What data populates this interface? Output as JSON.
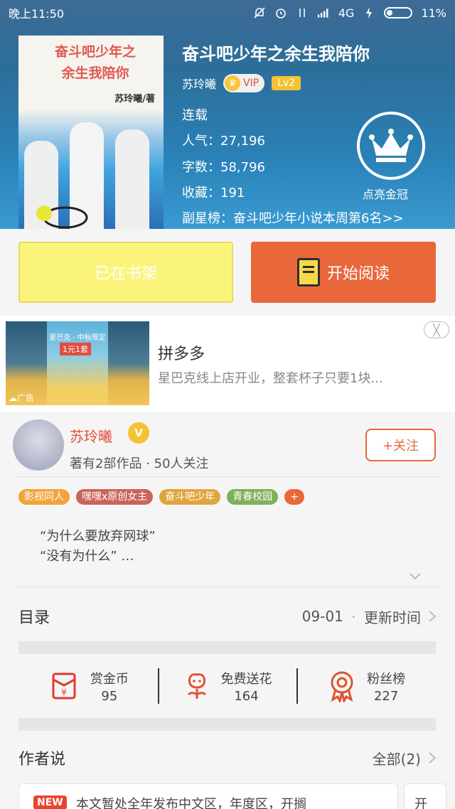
{
  "status_bar": {
    "time": "晚上11:50",
    "network": "4G",
    "battery": "11%"
  },
  "book": {
    "title": "奋斗吧少年之余生我陪你",
    "cover_title_lines": [
      "奋斗吧少年之",
      "余生我陪你"
    ],
    "cover_author": "苏玲曦/著",
    "author": "苏玲曦",
    "vip_label": "VIP",
    "level": "Lv2",
    "status": "连载",
    "popularity": "人气：27,196",
    "word_count": "字数：58,796",
    "favorites": "收藏：191",
    "ranking": "副星榜：奋斗吧少年小说本周第6名>>",
    "crown_label": "点亮金冠"
  },
  "actions": {
    "shelf": "已在书架",
    "read": "开始阅读"
  },
  "ad": {
    "title": "拼多多",
    "desc": "星巴克线上店开业，整套杯子只要1块...",
    "tag": "广告",
    "poster_text": "星巴克 · 中秋限定",
    "poster_price": "1元1套",
    "close": "╳"
  },
  "writer": {
    "name": "苏玲曦",
    "v": "V",
    "meta": "著有2部作品 · 50人关注",
    "follow": "+关注"
  },
  "tags": [
    {
      "label": "影视同人",
      "color": "#f0a43a"
    },
    {
      "label": "嘿嘿x原创女主",
      "color": "#c9655a"
    },
    {
      "label": "奋斗吧少年",
      "color": "#e0a53d"
    },
    {
      "label": "青春校园",
      "color": "#7fb05a"
    },
    {
      "label": "+",
      "color": "#e8683b"
    }
  ],
  "quotes": [
    "“为什么要放弃网球”",
    "“没有为什么” …"
  ],
  "toc": {
    "title": "目录",
    "date": "09-01",
    "sep": "·",
    "update": "更新时间"
  },
  "stats": [
    {
      "label": "赏金币",
      "count": "95",
      "icon": "red-envelope-icon"
    },
    {
      "label": "免费送花",
      "count": "164",
      "icon": "flower-icon"
    },
    {
      "label": "粉丝榜",
      "count": "227",
      "icon": "medal-icon"
    }
  ],
  "author_says": {
    "title": "作者说",
    "all": "全部(2)",
    "new_badge": "NEW",
    "post": "本文暂处全年发布中文区，年度区，开搁",
    "post2": "开"
  }
}
